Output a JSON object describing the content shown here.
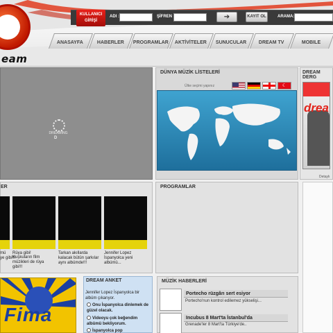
{
  "header": {
    "logo_text": "eam",
    "login_button": "KULLANICI GİRİŞİ",
    "username_label": "ADI :",
    "password_label": "ŞİFREN :",
    "go_icon": "arrow-right-icon",
    "register_button": "KAYIT OL",
    "search_label": "ARAMA:"
  },
  "nav": {
    "tabs": [
      {
        "label": "ANASAYFA"
      },
      {
        "label": "HABERLER"
      },
      {
        "label": "PROGRAMLAR"
      },
      {
        "label": "AKTİVİTELER"
      },
      {
        "label": "SUNUCULAR"
      },
      {
        "label": "DREAM TV"
      },
      {
        "label": "MOBILE"
      }
    ]
  },
  "player": {
    "status_text": "DREAMING",
    "letter": "D"
  },
  "world_charts": {
    "title": "DÜNYA MÜZİK LİSTELERİ",
    "country_prompt": "Ülke seçimi yapınız",
    "flags": [
      "us",
      "de",
      "ge",
      "tr"
    ]
  },
  "magazine": {
    "title": "DREAM DERG",
    "cover_title": "drea",
    "link": "Detaylı"
  },
  "videos": {
    "title": "ER",
    "items": [
      {
        "caption": "mü\nye gibi!!!"
      },
      {
        "caption": "Rüya gibi!"
      },
      {
        "caption": "Kuşkuların film müzikleri de rüya gibi!!!"
      },
      {
        "caption": "Tarkan akıllarda kalacak bütün şarkılar aynı albümde!!!"
      },
      {
        "caption": "Jennifer Lopez İspanyolca yeni albümü..."
      }
    ]
  },
  "programs": {
    "title": "PROGRAMLAR"
  },
  "poll": {
    "title": "DREAM ANKET",
    "question": "Jennifer Lopez İspanyolca bir albüm çıkarıyor.",
    "options": [
      "Onu İspanyolca dinlemek de güzel olacak.",
      "Videoyu çok beğendim albümü bekliyorum.",
      "İspanyolca pop"
    ]
  },
  "music_news": {
    "title": "MÜZİK HABERLERİ",
    "items": [
      {
        "headline": "Portecho rüzgârı sert esiyor",
        "summary": "Portecho'nun kontrol edilemez yükselişi..."
      },
      {
        "headline": "Incubus 8 Mart'ta İstanbul'da",
        "summary": "Grenade'ler 8 Mart'ta Türkiye'de.."
      }
    ]
  },
  "ad": {
    "brand": "Fima"
  }
}
